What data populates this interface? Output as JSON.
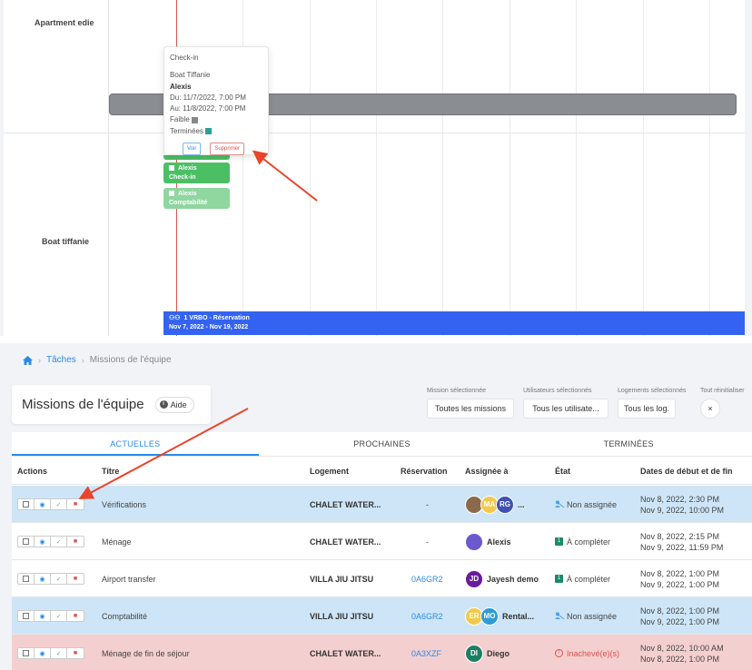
{
  "calendar": {
    "rows": [
      {
        "label": "Apartment edie"
      },
      {
        "label": "Boat tiffanie"
      }
    ],
    "popover": {
      "title": "Check-in",
      "property": "Boat Tiffanie",
      "person": "Alexis",
      "from": "Du: 11/7/2022, 7:00 PM",
      "to": "Au: 11/8/2022, 7:00 PM",
      "priority": "Faible",
      "status": "Terminées",
      "voir_label": "Voir",
      "supprimer_label": "Supprimer"
    },
    "chips": [
      {
        "name": "Alexis",
        "type": "Check-in"
      },
      {
        "name": "Alexis",
        "type": "Comptabilité"
      }
    ],
    "reservation": {
      "title": "1 VRBO - Réservation",
      "dates": "Nov 7, 2022 - Nov 19, 2022"
    }
  },
  "breadcrumb": {
    "home": "home-icon",
    "items": [
      "Tâches",
      "Missions de l'équipe"
    ]
  },
  "page": {
    "title": "Missions de l'équipe",
    "help_label": "Aide"
  },
  "filters": [
    {
      "label": "Mission sélectionnée",
      "value": "Toutes les missions"
    },
    {
      "label": "Utilisateurs sélectionnés",
      "value": "Tous les utilisate..."
    },
    {
      "label": "Logements sélectionnés",
      "value": "Tous les log."
    },
    {
      "label": "Tout réinitialiser",
      "value": "×"
    }
  ],
  "tabs": [
    "ACTUELLES",
    "PROCHAINES",
    "TERMINÉES"
  ],
  "columns": [
    "Actions",
    "Titre",
    "Logement",
    "Réservation",
    "Assignée à",
    "État",
    "Dates de début et de fin"
  ],
  "rows": [
    {
      "title": "Vérifications",
      "logement": "CHALET WATER...",
      "reservation": "-",
      "assignees": [
        {
          "initials": "",
          "color": "#8a6a4a"
        },
        {
          "initials": "MA",
          "color": "#f2c94c"
        },
        {
          "initials": "RG",
          "color": "#3f51b5"
        }
      ],
      "assignee_name": "...",
      "state": "Non assignée",
      "start": "Nov 8, 2022, 2:30 PM",
      "end": "Nov 9, 2022, 10:00 PM",
      "highlight": "blue"
    },
    {
      "title": "Ménage",
      "logement": "CHALET WATER...",
      "reservation": "-",
      "assignees": [
        {
          "initials": "",
          "color": "#6a5acd"
        }
      ],
      "assignee_name": "Alexis",
      "state": "À compléter",
      "start": "Nov 8, 2022, 2:15 PM",
      "end": "Nov 9, 2022, 11:59 PM",
      "highlight": "white"
    },
    {
      "title": "Airport transfer",
      "logement": "VILLA JIU JITSU",
      "reservation": "0A6GR2",
      "assignees": [
        {
          "initials": "JD",
          "color": "#6a1b9a"
        }
      ],
      "assignee_name": "Jayesh demo",
      "state": "À compléter",
      "start": "Nov 8, 2022, 1:00 PM",
      "end": "Nov 9, 2022, 1:00 PM",
      "highlight": "white"
    },
    {
      "title": "Comptabilité",
      "logement": "VILLA JIU JITSU",
      "reservation": "0A6GR2",
      "assignees": [
        {
          "initials": "ER",
          "color": "#f2c94c"
        },
        {
          "initials": "MO",
          "color": "#2e9bd6"
        }
      ],
      "assignee_name": "Rental...",
      "state": "Non assignée",
      "start": "Nov 8, 2022, 1:00 PM",
      "end": "Nov 9, 2022, 1:00 PM",
      "highlight": "blue"
    },
    {
      "title": "Ménage de fin de séjour",
      "logement": "CHALET WATER...",
      "reservation": "0A3XZF",
      "assignees": [
        {
          "initials": "DI",
          "color": "#1e7e64"
        }
      ],
      "assignee_name": "Diego",
      "state": "Inachevé(e)(s)",
      "start": "Nov 8, 2022, 10:00 AM",
      "end": "Nov 8, 2022, 1:00 PM",
      "highlight": "red"
    }
  ],
  "colors": {
    "accent": "#2a8be8",
    "arrow": "#e8452c",
    "today_line": "#d9534f",
    "reservation_bar": "#3363f0",
    "chip_green": "#4cbf65"
  }
}
